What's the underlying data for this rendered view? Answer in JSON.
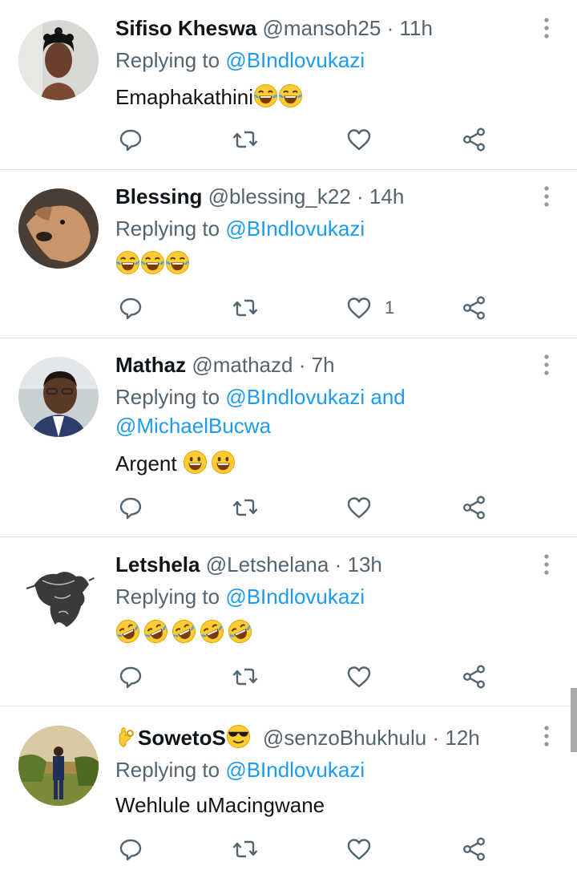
{
  "colors": {
    "accent": "#1d9bf0",
    "secondary_text": "#536471",
    "primary_text": "#0f1419",
    "divider": "#e1e4e6"
  },
  "replying_prefix": "Replying to",
  "tweets": [
    {
      "name": "Sifiso Kheswa",
      "handle": "@mansoh25",
      "dot": "·",
      "time": "11h",
      "reply_to": "@BIndlovukazi",
      "reply_and": "",
      "reply_to2": "",
      "text": "Emaphakathini",
      "emoji": [
        "face-with-tears-of-joy",
        "face-with-tears-of-joy"
      ],
      "like_count": ""
    },
    {
      "name": "Blessing",
      "handle": "@blessing_k22",
      "dot": "·",
      "time": "14h",
      "reply_to": "@BIndlovukazi",
      "reply_and": "",
      "reply_to2": "",
      "text": "",
      "emoji": [
        "face-with-tears-of-joy",
        "face-with-tears-of-joy",
        "face-with-tears-of-joy"
      ],
      "like_count": "1"
    },
    {
      "name": "Mathaz",
      "handle": "@mathazd",
      "dot": "·",
      "time": "7h",
      "reply_to": "@BIndlovukazi",
      "reply_and": "and",
      "reply_to2": "@MichaelBucwa",
      "text": "Argent ",
      "emoji": [
        "grinning-face",
        "grinning-face"
      ],
      "like_count": ""
    },
    {
      "name": "Letshela",
      "handle": "@Letshelana",
      "dot": "·",
      "time": "13h",
      "reply_to": "@BIndlovukazi",
      "reply_and": "",
      "reply_to2": "",
      "text": "",
      "emoji": [
        "rolling-on-the-floor-laughing",
        "rolling-on-the-floor-laughing",
        "rolling-on-the-floor-laughing",
        "rolling-on-the-floor-laughing",
        "rolling-on-the-floor-laughing"
      ],
      "like_count": ""
    },
    {
      "name": "SowetoS",
      "name_prefix_emoji": "ok-hand",
      "name_suffix_emoji": "smiling-face-with-sunglasses",
      "handle": "@senzoBhukhulu",
      "dot": "·",
      "time": "12h",
      "reply_to": "@BIndlovukazi",
      "reply_and": "",
      "reply_to2": "",
      "text": "Wehlule uMacingwane",
      "emoji": [],
      "like_count": ""
    }
  ]
}
